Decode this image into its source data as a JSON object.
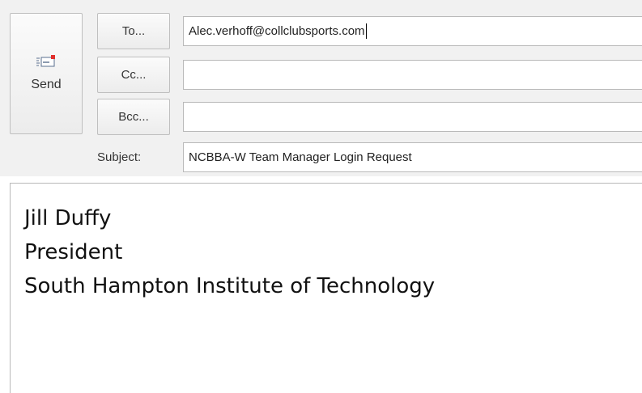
{
  "toolbar": {
    "send_label": "Send",
    "send_icon": "send-envelope-icon",
    "to_label": "To...",
    "cc_label": "Cc...",
    "bcc_label": "Bcc..."
  },
  "fields": {
    "to_value": "Alec.verhoff@collclubsports.com",
    "cc_value": "",
    "bcc_value": "",
    "subject_label": "Subject:",
    "subject_value": "NCBBA-W Team Manager Login Request"
  },
  "message": {
    "signature": [
      "Jill Duffy",
      "President",
      "South Hampton Institute of Technology"
    ]
  },
  "colors": {
    "header_background": "#f1f1f1",
    "send_icon_accent": "#e1302d"
  }
}
